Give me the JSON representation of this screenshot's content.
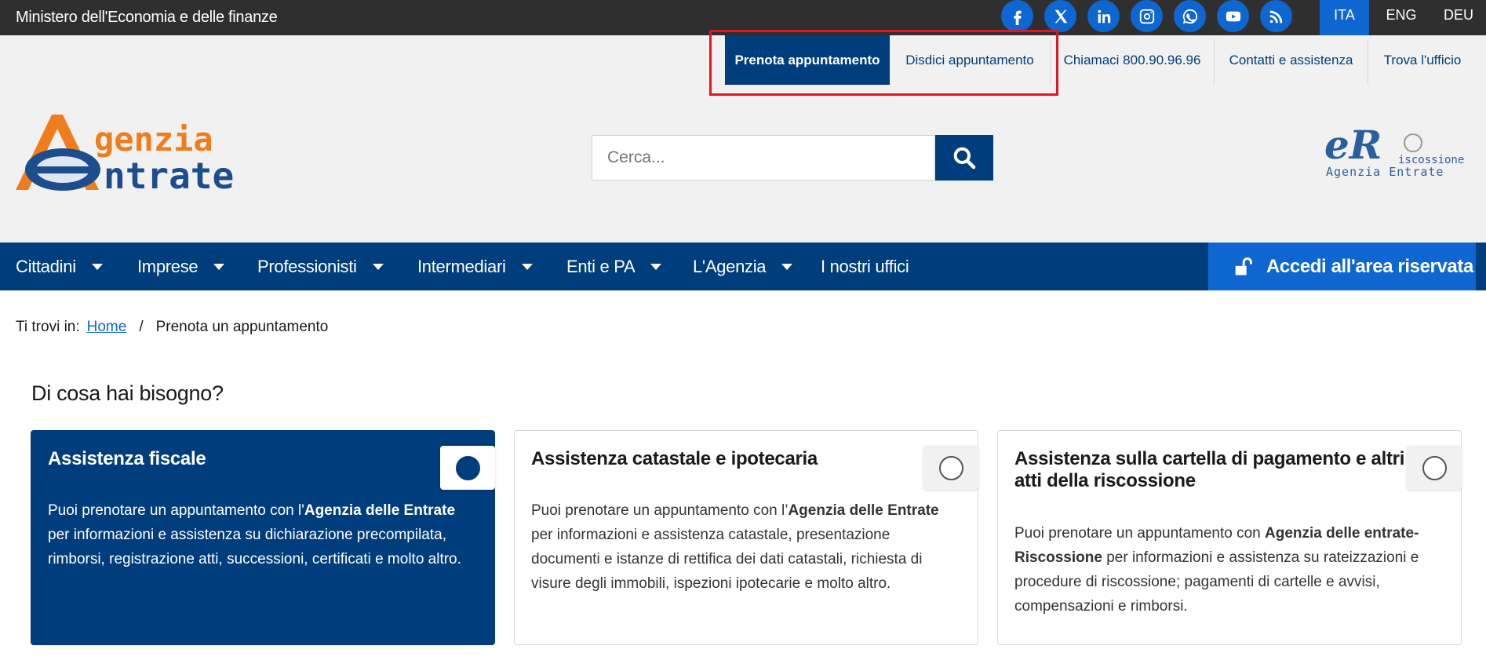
{
  "topbar": {
    "ministry": "Ministero dell'Economia e delle finanze",
    "socials": [
      {
        "name": "facebook-icon"
      },
      {
        "name": "x-icon"
      },
      {
        "name": "linkedin-icon"
      },
      {
        "name": "instagram-icon"
      },
      {
        "name": "whatsapp-icon"
      },
      {
        "name": "youtube-icon"
      },
      {
        "name": "rss-icon"
      }
    ],
    "languages": [
      "ITA",
      "ENG",
      "DEU"
    ],
    "active_language": "ITA"
  },
  "utility": {
    "book": "Prenota appuntamento",
    "cancel": "Disdici appuntamento",
    "call": "Chiamaci 800.90.96.96",
    "contacts": "Contatti e assistenza",
    "office": "Trova l'ufficio"
  },
  "logo": {
    "line1": "genzia",
    "line2": "ntrate"
  },
  "search": {
    "placeholder": "Cerca..."
  },
  "er_logo": {
    "letters": "eR",
    "word": "iscossione",
    "agency": "Agenzia Entrate"
  },
  "nav": {
    "items": [
      "Cittadini",
      "Imprese",
      "Professionisti",
      "Intermediari",
      "Enti e PA",
      "L'Agenzia",
      "I nostri uffici"
    ],
    "login": "Accedi all'area riservata"
  },
  "breadcrumb": {
    "prefix": "Ti trovi in:",
    "home": "Home",
    "separator": "/",
    "current": "Prenota un appuntamento"
  },
  "main": {
    "heading": "Di cosa hai bisogno?",
    "cards": [
      {
        "title": "Assistenza fiscale",
        "text_before": "Puoi prenotare un appuntamento con l'",
        "bold": "Agenzia delle Entrate",
        "text_after": " per informazioni e assistenza su dichiarazione precompilata, rimborsi, registrazione atti, successioni, certificati e molto altro.",
        "selected": true
      },
      {
        "title": "Assistenza catastale e ipotecaria",
        "text_before": "Puoi prenotare un appuntamento con l’",
        "bold": "Agenzia delle Entrate",
        "text_after": " per informazioni e assistenza catastale, presentazione documenti e istanze di rettifica dei dati catastali, richiesta di visure degli immobili, ispezioni ipotecarie e molto altro.",
        "selected": false
      },
      {
        "title": "Assistenza sulla cartella di pagamento e altri atti della riscossione",
        "text_before": "Puoi prenotare un appuntamento con ",
        "bold": "Agenzia delle entrate-Riscossione",
        "text_after": " per informazioni e assistenza su rateizzazioni e procedure di riscossione; pagamenti di cartelle e avvisi, compensazioni e rimborsi.",
        "selected": false
      }
    ]
  },
  "colors": {
    "dark_bar": "#2f2f2f",
    "primary_blue": "#003d7c",
    "accent_blue": "#0e66d0",
    "header_bg": "#f1f1f1",
    "logo_orange": "#f07d1c",
    "highlight_red": "#e2161f"
  }
}
